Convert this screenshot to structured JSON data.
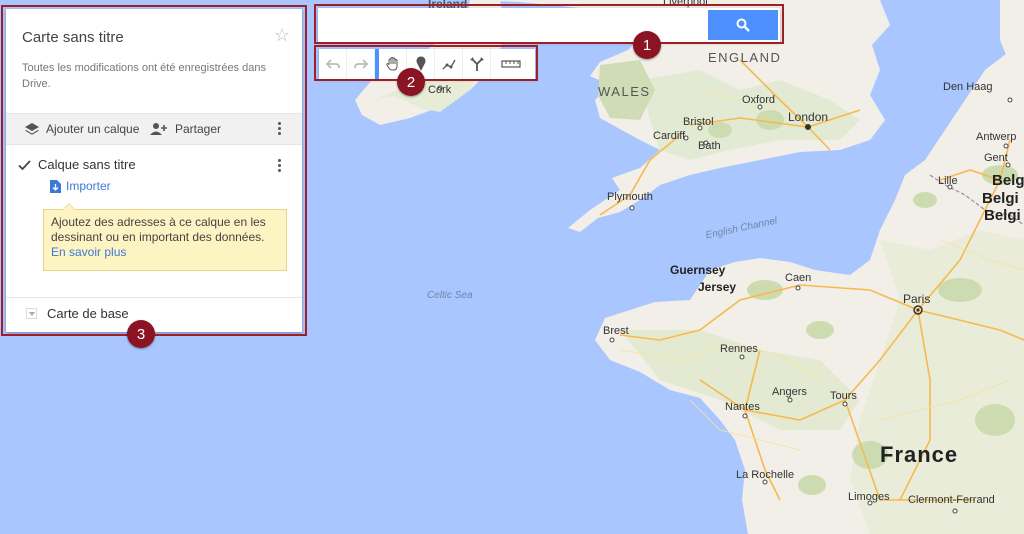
{
  "panel": {
    "title": "Carte sans titre",
    "subtitle": "Toutes les modifications ont été enregistrées dans Drive.",
    "add_layer_label": "Ajouter un calque",
    "share_label": "Partager",
    "layer_name": "Calque sans titre",
    "import_label": "Importer",
    "tooltip_text": "Ajoutez des adresses à ce calque en les dessinant ou en important des données.",
    "tooltip_link": "En savoir plus",
    "basemap_label": "Carte de base"
  },
  "search": {
    "placeholder": ""
  },
  "toolbar": {
    "tools": [
      "undo-icon",
      "redo-icon",
      "hand-icon",
      "marker-icon",
      "draw-line-icon",
      "directions-icon",
      "ruler-icon"
    ]
  },
  "annotations": {
    "badge1": "1",
    "badge2": "2",
    "badge3": "3"
  },
  "map": {
    "labels": {
      "ireland": "Ireland",
      "liverpool": "Liverpool",
      "england": "ENGLAND",
      "wales": "WALES",
      "cork": "Cork",
      "oxford": "Oxford",
      "london": "London",
      "bristol": "Bristol",
      "cardiff": "Cardiff",
      "bath": "Bath",
      "plymouth": "Plymouth",
      "english_channel": "English Channel",
      "celtic_sea": "Celtic Sea",
      "guernsey": "Guernsey",
      "jersey": "Jersey",
      "caen": "Caen",
      "paris": "Paris",
      "brest": "Brest",
      "rennes": "Rennes",
      "angers": "Angers",
      "tours": "Tours",
      "nantes": "Nantes",
      "la_rochelle": "La Rochelle",
      "limoges": "Limoges",
      "clermont": "Clermont-Ferrand",
      "france": "France",
      "den_haag": "Den Haag",
      "antwerp": "Antwerp",
      "gent": "Gent",
      "lille": "Lille",
      "belg1": "Belg",
      "belg2": "Belgi",
      "belg3": "Belgi"
    },
    "colors": {
      "sea": "#a9c6ff",
      "land": "#f2efe9",
      "green": "#cddcb0",
      "road": "#f7b94d"
    }
  }
}
